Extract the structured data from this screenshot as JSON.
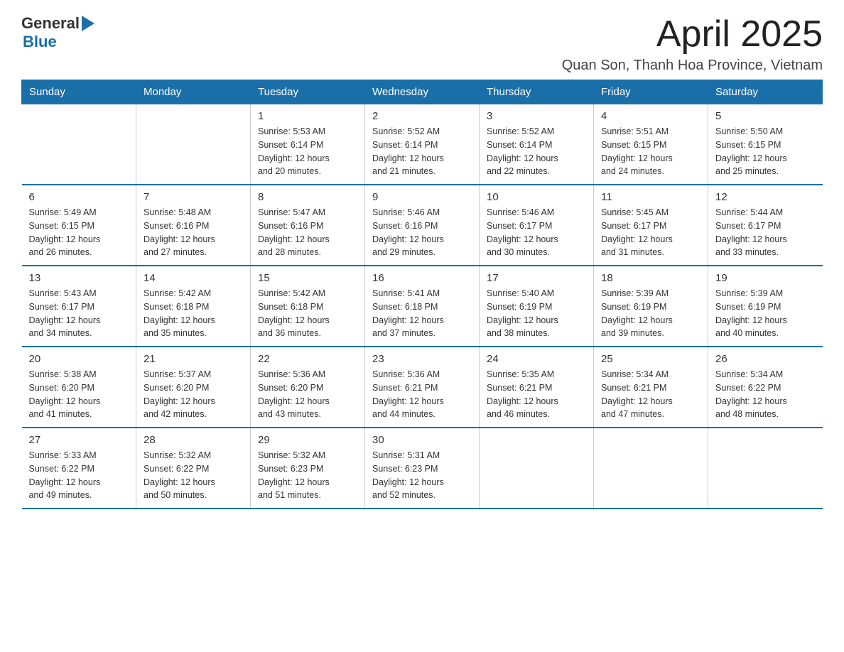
{
  "logo": {
    "general": "General",
    "blue": "Blue"
  },
  "title": "April 2025",
  "subtitle": "Quan Son, Thanh Hoa Province, Vietnam",
  "weekdays": [
    "Sunday",
    "Monday",
    "Tuesday",
    "Wednesday",
    "Thursday",
    "Friday",
    "Saturday"
  ],
  "weeks": [
    [
      {
        "day": "",
        "info": ""
      },
      {
        "day": "",
        "info": ""
      },
      {
        "day": "1",
        "sunrise": "5:53 AM",
        "sunset": "6:14 PM",
        "daylight": "12 hours and 20 minutes."
      },
      {
        "day": "2",
        "sunrise": "5:52 AM",
        "sunset": "6:14 PM",
        "daylight": "12 hours and 21 minutes."
      },
      {
        "day": "3",
        "sunrise": "5:52 AM",
        "sunset": "6:14 PM",
        "daylight": "12 hours and 22 minutes."
      },
      {
        "day": "4",
        "sunrise": "5:51 AM",
        "sunset": "6:15 PM",
        "daylight": "12 hours and 24 minutes."
      },
      {
        "day": "5",
        "sunrise": "5:50 AM",
        "sunset": "6:15 PM",
        "daylight": "12 hours and 25 minutes."
      }
    ],
    [
      {
        "day": "6",
        "sunrise": "5:49 AM",
        "sunset": "6:15 PM",
        "daylight": "12 hours and 26 minutes."
      },
      {
        "day": "7",
        "sunrise": "5:48 AM",
        "sunset": "6:16 PM",
        "daylight": "12 hours and 27 minutes."
      },
      {
        "day": "8",
        "sunrise": "5:47 AM",
        "sunset": "6:16 PM",
        "daylight": "12 hours and 28 minutes."
      },
      {
        "day": "9",
        "sunrise": "5:46 AM",
        "sunset": "6:16 PM",
        "daylight": "12 hours and 29 minutes."
      },
      {
        "day": "10",
        "sunrise": "5:46 AM",
        "sunset": "6:17 PM",
        "daylight": "12 hours and 30 minutes."
      },
      {
        "day": "11",
        "sunrise": "5:45 AM",
        "sunset": "6:17 PM",
        "daylight": "12 hours and 31 minutes."
      },
      {
        "day": "12",
        "sunrise": "5:44 AM",
        "sunset": "6:17 PM",
        "daylight": "12 hours and 33 minutes."
      }
    ],
    [
      {
        "day": "13",
        "sunrise": "5:43 AM",
        "sunset": "6:17 PM",
        "daylight": "12 hours and 34 minutes."
      },
      {
        "day": "14",
        "sunrise": "5:42 AM",
        "sunset": "6:18 PM",
        "daylight": "12 hours and 35 minutes."
      },
      {
        "day": "15",
        "sunrise": "5:42 AM",
        "sunset": "6:18 PM",
        "daylight": "12 hours and 36 minutes."
      },
      {
        "day": "16",
        "sunrise": "5:41 AM",
        "sunset": "6:18 PM",
        "daylight": "12 hours and 37 minutes."
      },
      {
        "day": "17",
        "sunrise": "5:40 AM",
        "sunset": "6:19 PM",
        "daylight": "12 hours and 38 minutes."
      },
      {
        "day": "18",
        "sunrise": "5:39 AM",
        "sunset": "6:19 PM",
        "daylight": "12 hours and 39 minutes."
      },
      {
        "day": "19",
        "sunrise": "5:39 AM",
        "sunset": "6:19 PM",
        "daylight": "12 hours and 40 minutes."
      }
    ],
    [
      {
        "day": "20",
        "sunrise": "5:38 AM",
        "sunset": "6:20 PM",
        "daylight": "12 hours and 41 minutes."
      },
      {
        "day": "21",
        "sunrise": "5:37 AM",
        "sunset": "6:20 PM",
        "daylight": "12 hours and 42 minutes."
      },
      {
        "day": "22",
        "sunrise": "5:36 AM",
        "sunset": "6:20 PM",
        "daylight": "12 hours and 43 minutes."
      },
      {
        "day": "23",
        "sunrise": "5:36 AM",
        "sunset": "6:21 PM",
        "daylight": "12 hours and 44 minutes."
      },
      {
        "day": "24",
        "sunrise": "5:35 AM",
        "sunset": "6:21 PM",
        "daylight": "12 hours and 46 minutes."
      },
      {
        "day": "25",
        "sunrise": "5:34 AM",
        "sunset": "6:21 PM",
        "daylight": "12 hours and 47 minutes."
      },
      {
        "day": "26",
        "sunrise": "5:34 AM",
        "sunset": "6:22 PM",
        "daylight": "12 hours and 48 minutes."
      }
    ],
    [
      {
        "day": "27",
        "sunrise": "5:33 AM",
        "sunset": "6:22 PM",
        "daylight": "12 hours and 49 minutes."
      },
      {
        "day": "28",
        "sunrise": "5:32 AM",
        "sunset": "6:22 PM",
        "daylight": "12 hours and 50 minutes."
      },
      {
        "day": "29",
        "sunrise": "5:32 AM",
        "sunset": "6:23 PM",
        "daylight": "12 hours and 51 minutes."
      },
      {
        "day": "30",
        "sunrise": "5:31 AM",
        "sunset": "6:23 PM",
        "daylight": "12 hours and 52 minutes."
      },
      {
        "day": "",
        "info": ""
      },
      {
        "day": "",
        "info": ""
      },
      {
        "day": "",
        "info": ""
      }
    ]
  ]
}
